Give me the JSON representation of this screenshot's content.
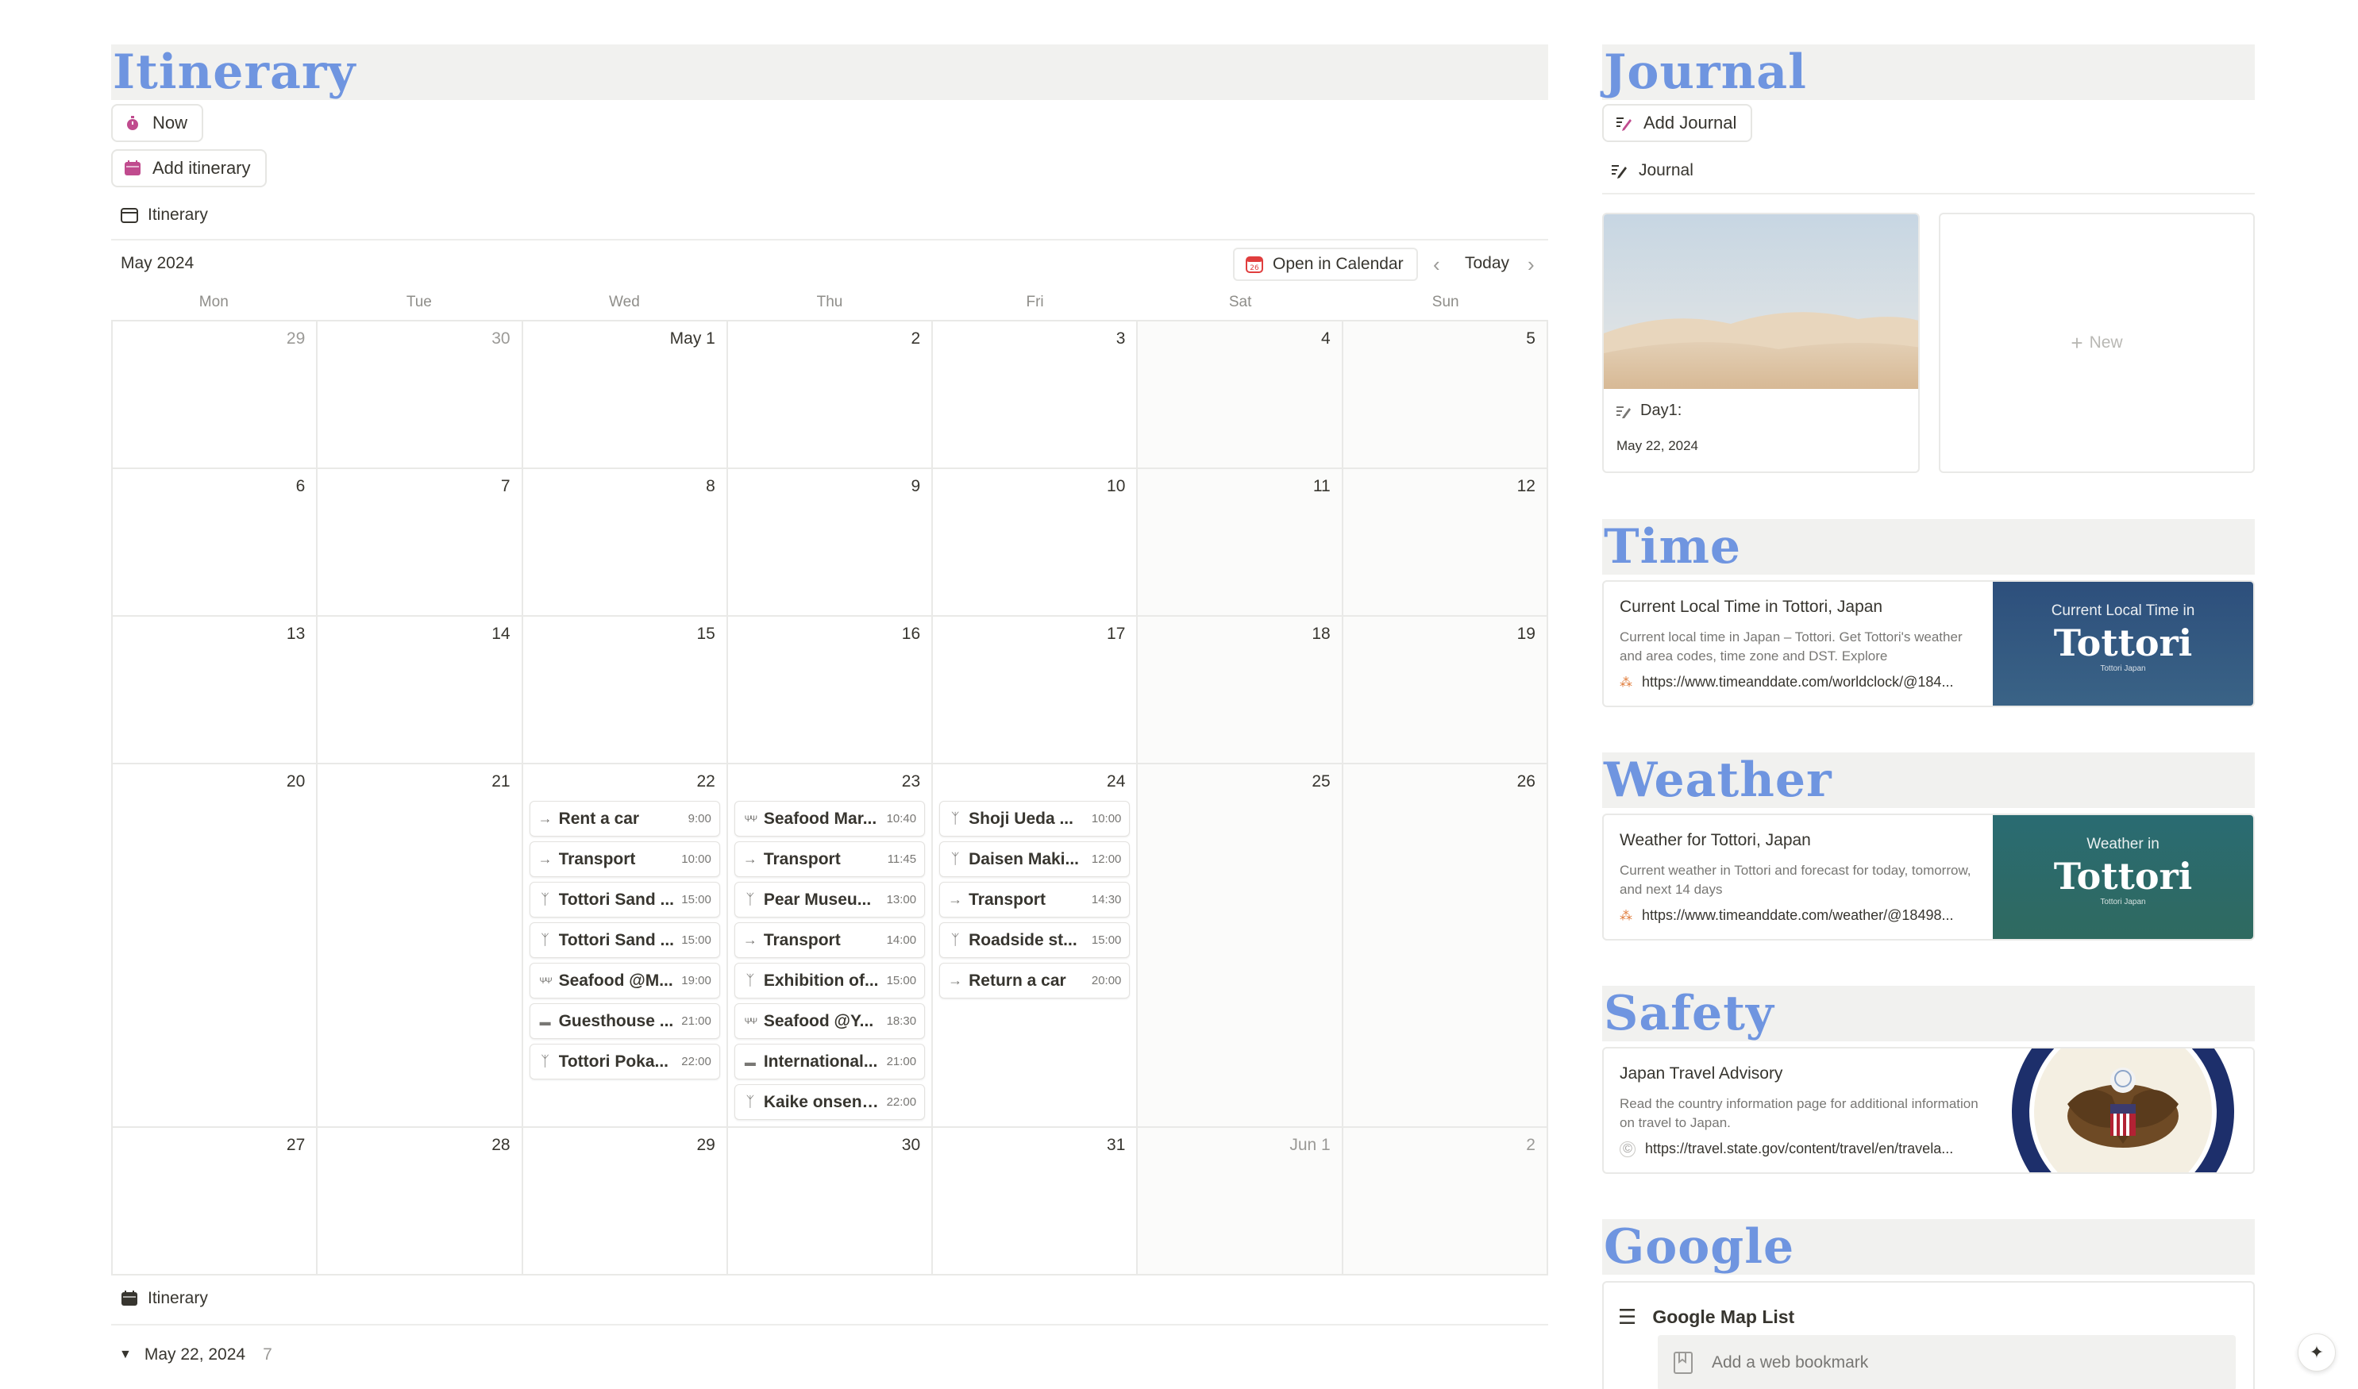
{
  "itinerary": {
    "heading": "Itinerary",
    "now_button": "Now",
    "add_button": "Add itinerary",
    "view_tab": "Itinerary",
    "month_label": "May 2024",
    "open_in_calendar": "Open in Calendar",
    "today": "Today",
    "weekdays": [
      "Mon",
      "Tue",
      "Wed",
      "Thu",
      "Fri",
      "Sat",
      "Sun"
    ],
    "weeks": [
      [
        {
          "d": "29",
          "muted": true
        },
        {
          "d": "30",
          "muted": true
        },
        {
          "d": "May 1"
        },
        {
          "d": "2"
        },
        {
          "d": "3"
        },
        {
          "d": "4"
        },
        {
          "d": "5"
        }
      ],
      [
        {
          "d": "6"
        },
        {
          "d": "7"
        },
        {
          "d": "8"
        },
        {
          "d": "9"
        },
        {
          "d": "10"
        },
        {
          "d": "11"
        },
        {
          "d": "12"
        }
      ],
      [
        {
          "d": "13"
        },
        {
          "d": "14"
        },
        {
          "d": "15"
        },
        {
          "d": "16"
        },
        {
          "d": "17"
        },
        {
          "d": "18"
        },
        {
          "d": "19"
        }
      ],
      [
        {
          "d": "20"
        },
        {
          "d": "21"
        },
        {
          "d": "22",
          "events": [
            {
              "icon": "arrow",
              "title": "Rent a car",
              "time": "9:00"
            },
            {
              "icon": "arrow",
              "title": "Transport",
              "time": "10:00"
            },
            {
              "icon": "walk",
              "title": "Tottori Sand ...",
              "time": "15:00"
            },
            {
              "icon": "walk",
              "title": "Tottori Sand ...",
              "time": "15:00"
            },
            {
              "icon": "fork",
              "title": "Seafood @M...",
              "time": "19:00"
            },
            {
              "icon": "bed",
              "title": "Guesthouse ...",
              "time": "21:00"
            },
            {
              "icon": "walk",
              "title": "Tottori Poka...",
              "time": "22:00"
            }
          ]
        },
        {
          "d": "23",
          "events": [
            {
              "icon": "fork",
              "title": "Seafood Mar...",
              "time": "10:40"
            },
            {
              "icon": "arrow",
              "title": "Transport",
              "time": "11:45"
            },
            {
              "icon": "walk",
              "title": "Pear Museu...",
              "time": "13:00"
            },
            {
              "icon": "arrow",
              "title": "Transport",
              "time": "14:00"
            },
            {
              "icon": "walk",
              "title": "Exhibition of...",
              "time": "15:00"
            },
            {
              "icon": "fork",
              "title": "Seafood @Y...",
              "time": "18:30"
            },
            {
              "icon": "bed",
              "title": "International...",
              "time": "21:00"
            },
            {
              "icon": "walk",
              "title": "Kaike onsen ...",
              "time": "22:00"
            }
          ]
        },
        {
          "d": "24",
          "events": [
            {
              "icon": "walk",
              "title": "Shoji Ueda ...",
              "time": "10:00"
            },
            {
              "icon": "walk",
              "title": "Daisen Maki...",
              "time": "12:00"
            },
            {
              "icon": "arrow",
              "title": "Transport",
              "time": "14:30"
            },
            {
              "icon": "walk",
              "title": "Roadside st...",
              "time": "15:00"
            },
            {
              "icon": "arrow",
              "title": "Return a car",
              "time": "20:00"
            }
          ]
        },
        {
          "d": "25"
        },
        {
          "d": "26"
        }
      ],
      [
        {
          "d": "27"
        },
        {
          "d": "28"
        },
        {
          "d": "29"
        },
        {
          "d": "30"
        },
        {
          "d": "31"
        },
        {
          "d": "Jun 1",
          "muted": true
        },
        {
          "d": "2",
          "muted": true
        }
      ]
    ],
    "list_view_tab": "Itinerary",
    "group_label": "May 22, 2024",
    "group_count": "7"
  },
  "journal": {
    "heading": "Journal",
    "add_button": "Add Journal",
    "view_tab": "Journal",
    "card_title": "Day1:",
    "card_date": "May 22, 2024",
    "new_label": "New"
  },
  "time": {
    "heading": "Time",
    "title": "Current Local Time in Tottori, Japan",
    "desc": "Current local time in Japan – Tottori. Get Tottori's weather and area codes, time zone and DST. Explore",
    "url": "https://www.timeanddate.com/worldclock/@184...",
    "img_top": "Current Local Time in",
    "img_big": "Tottori",
    "img_small": "Tottori Japan"
  },
  "weather": {
    "heading": "Weather",
    "title": "Weather for Tottori, Japan",
    "desc": "Current weather in Tottori and forecast for today, tomorrow, and next 14 days",
    "url": "https://www.timeanddate.com/weather/@18498...",
    "img_top": "Weather in",
    "img_big": "Tottori",
    "img_small": "Tottori Japan"
  },
  "safety": {
    "heading": "Safety",
    "title": "Japan Travel Advisory",
    "desc": "Read the country information page for additional information on travel to Japan.",
    "url": "https://travel.state.gov/content/travel/en/travela..."
  },
  "google": {
    "heading": "Google",
    "list_title": "Google Map List",
    "add_bookmark": "Add a web bookmark"
  },
  "colors": {
    "heading": "#6f95e0",
    "accent_pink": "#c04b8e"
  }
}
